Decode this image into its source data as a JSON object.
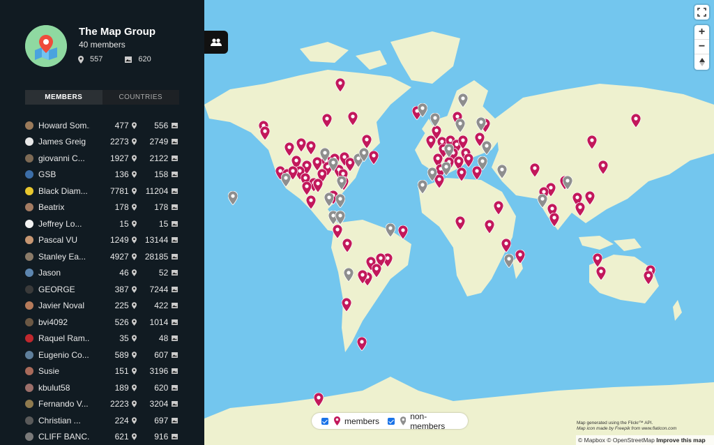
{
  "group": {
    "title": "The Map Group",
    "members_label": "40 members",
    "pin_count": "557",
    "photo_count": "620"
  },
  "tabs": {
    "members": "MEMBERS",
    "countries": "COUNTRIES"
  },
  "members": [
    {
      "name": "Howard Som...",
      "pins": "477",
      "photos": "556",
      "color": "#9a7a5a"
    },
    {
      "name": "James Greig",
      "pins": "2273",
      "photos": "2749",
      "color": "#e8e8e8"
    },
    {
      "name": "giovanni C...",
      "pins": "1927",
      "photos": "2122",
      "color": "#7d6a55"
    },
    {
      "name": "GSB",
      "pins": "136",
      "photos": "158",
      "color": "#3c6ea8"
    },
    {
      "name": "Black Diam...",
      "pins": "7781",
      "photos": "11204",
      "color": "#e8c72e"
    },
    {
      "name": "Beatrix",
      "pins": "178",
      "photos": "178",
      "color": "#a37b62"
    },
    {
      "name": "Jeffrey Lo...",
      "pins": "15",
      "photos": "15",
      "color": "#f2f2f2"
    },
    {
      "name": "Pascal VU",
      "pins": "1249",
      "photos": "13144",
      "color": "#c69672"
    },
    {
      "name": "Stanley Ea...",
      "pins": "4927",
      "photos": "28185",
      "color": "#8a7a68"
    },
    {
      "name": "Jason",
      "pins": "46",
      "photos": "52",
      "color": "#5d86b0"
    },
    {
      "name": "GEORGE",
      "pins": "387",
      "photos": "7244",
      "color": "#3a3a3a"
    },
    {
      "name": "Javier Noval",
      "pins": "225",
      "photos": "422",
      "color": "#b57a5a"
    },
    {
      "name": "bvi4092",
      "pins": "526",
      "photos": "1014",
      "color": "#6b5844"
    },
    {
      "name": "Raquel Ram...",
      "pins": "35",
      "photos": "48",
      "color": "#c0282e"
    },
    {
      "name": "Eugenio Co...",
      "pins": "589",
      "photos": "607",
      "color": "#5f7f9c"
    },
    {
      "name": "Susie",
      "pins": "151",
      "photos": "3196",
      "color": "#a86a5a"
    },
    {
      "name": "kbulut58",
      "pins": "189",
      "photos": "620",
      "color": "#9c6f6a"
    },
    {
      "name": "Fernando V...",
      "pins": "2223",
      "photos": "3204",
      "color": "#8f7a4e"
    },
    {
      "name": "Christian ...",
      "pins": "224",
      "photos": "697",
      "color": "#5a5a5a"
    },
    {
      "name": "CLIFF BANC...",
      "pins": "621",
      "photos": "916",
      "color": "#7a7a7a"
    }
  ],
  "legend": {
    "members": "members",
    "non_members": "non-members"
  },
  "credits": {
    "line1": "Map generated using the Flickr™ API.",
    "line2": "Map icon made by Freepik from www.flaticon.com"
  },
  "attribution": {
    "mapbox": "© Mapbox",
    "osm": "© OpenStreetMap",
    "improve": "Improve this map"
  },
  "controls": {
    "zoom_in": "+",
    "zoom_out": "−"
  },
  "colors": {
    "member_pin": "#c2185b",
    "non_member_pin": "#8e8e8e",
    "ocean": "#73c6ee",
    "land": "#eef0cc"
  }
}
